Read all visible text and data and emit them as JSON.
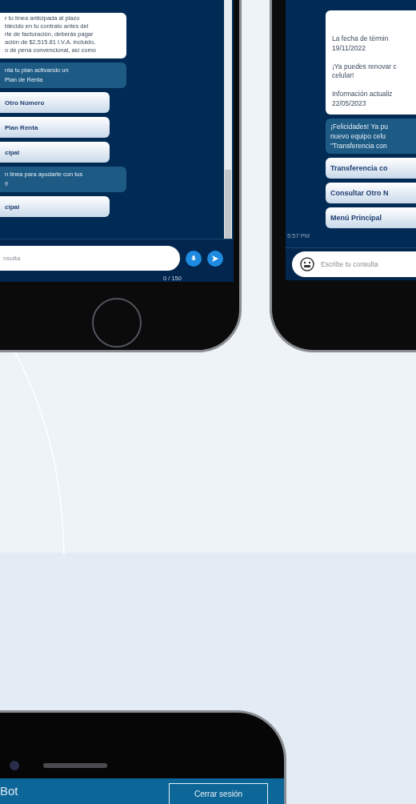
{
  "phones": [
    {
      "messages": [
        {
          "kind": "text",
          "text": "r tu línea anticipada al plazo\nblecido en tu contrato antes del\nrte de facturación, deberás pagar\nación de $2,515.81 I.V.A. incluido,\no de pena convencional, así como"
        },
        {
          "kind": "highlight",
          "text": "nta tu plan activando un\nPlan de Renta"
        },
        {
          "kind": "option",
          "text": "Otro Número"
        },
        {
          "kind": "option",
          "text": "Plan Renta"
        },
        {
          "kind": "option",
          "text": "cipal"
        },
        {
          "kind": "highlight",
          "text": "n línea para ayudarte con tus\n!!"
        },
        {
          "kind": "option",
          "text": "cipal"
        }
      ],
      "input": {
        "placeholder": "nsulta",
        "counter": "0 / 150"
      }
    },
    {
      "messages": [
        {
          "kind": "text",
          "text": "La fecha de términ\n19/11/2022\n\n¡Ya puedes renovar c\ncelular!\n\nInformación actualiz\n22/05/2023"
        },
        {
          "kind": "highlight",
          "text": "¡Felicidades! Ya pu\nnuevo equipo celu\n\"Transferencia con"
        },
        {
          "kind": "option",
          "text": "Transferencia co"
        },
        {
          "kind": "option",
          "text": "Consultar Otro N"
        },
        {
          "kind": "option",
          "text": "Menú Principal"
        },
        {
          "kind": "time",
          "text": "5:57 PM"
        }
      ],
      "input": {
        "placeholder": "Escribe tu consulta"
      }
    }
  ],
  "login_phone": {
    "header_title": "Bot",
    "logout_button": "Cerrar sesión"
  }
}
